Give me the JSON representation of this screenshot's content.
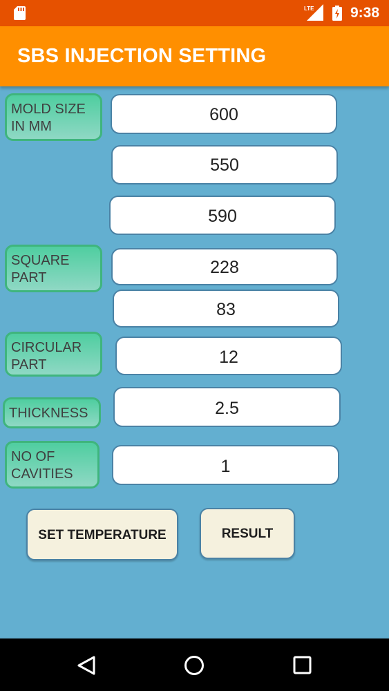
{
  "status_bar": {
    "network": "LTE",
    "time": "9:38"
  },
  "app_bar": {
    "title": "SBS INJECTION SETTING"
  },
  "form": {
    "mold_size_label": "MOLD SIZE\nIN MM",
    "mold_size_values": [
      "600",
      "550",
      "590"
    ],
    "square_part_label": "SQUARE\nPART",
    "square_part_values": [
      "228",
      "83"
    ],
    "circular_part_label": "CIRCULAR\nPART",
    "circular_part_value": "12",
    "thickness_label": "THICKNESS",
    "thickness_value": "2.5",
    "cavities_label": "NO OF\nCAVITIES",
    "cavities_value": "1"
  },
  "buttons": {
    "set_temperature": "SET TEMPERATURE",
    "result": "RESULT"
  },
  "icons": {
    "sd_card": "sd-card-icon",
    "signal": "signal-icon",
    "battery": "battery-icon",
    "back": "back-icon",
    "home": "home-icon",
    "recents": "recents-icon"
  },
  "colors": {
    "status_bar": "#e65100",
    "app_bar": "#ff8f00",
    "background": "#63afd0",
    "label_fill": "#4fcea0",
    "button_fill": "#f5f1de"
  }
}
